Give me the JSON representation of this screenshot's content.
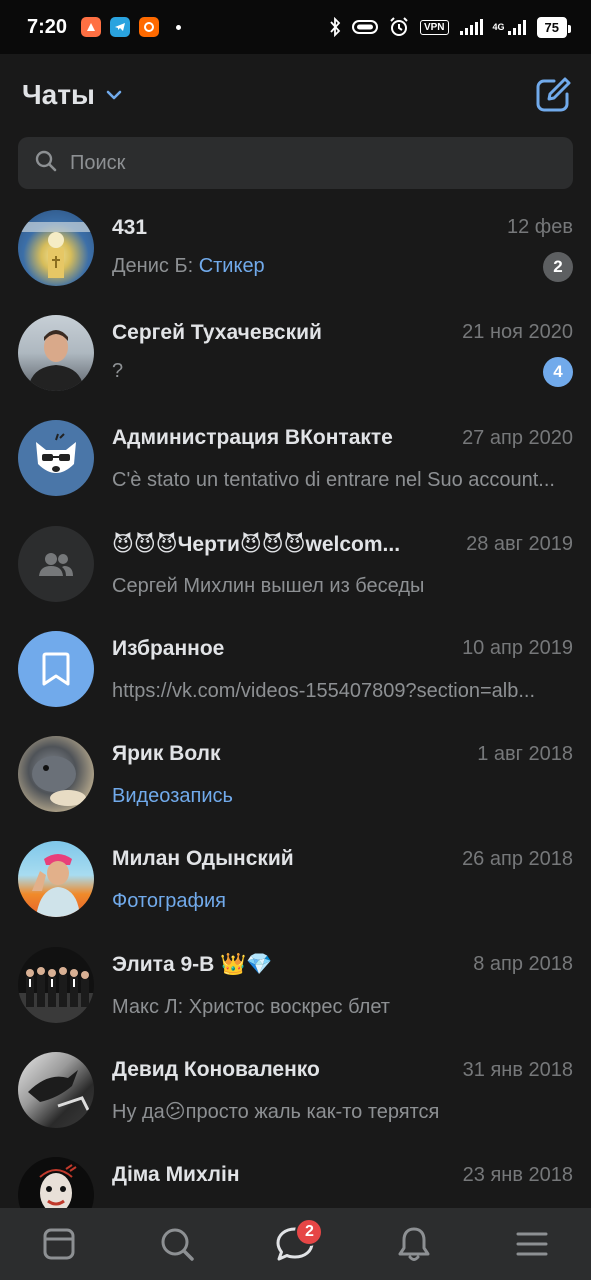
{
  "status_bar": {
    "time": "7:20",
    "battery": "75",
    "vpn": "VPN",
    "network": "4G"
  },
  "header": {
    "title": "Чаты"
  },
  "search": {
    "placeholder": "Поиск"
  },
  "chats": [
    {
      "name": "431",
      "date": "12 фев",
      "sender": "Денис Б: ",
      "message": "Стикер",
      "message_is_link": true,
      "badge": "2",
      "badge_style": "gray"
    },
    {
      "name": "Сергей Тухачевский",
      "date": "21 ноя 2020",
      "message": "?",
      "badge": "4",
      "badge_style": "blue"
    },
    {
      "name": "Администрация ВКонтакте",
      "date": "27 апр 2020",
      "message": "C'è stato un tentativo di entrare nel Suo account..."
    },
    {
      "name": "😈😈😈Черти😈😈😈welcom...",
      "date": "28 авг 2019",
      "message": "Сергей Михлин вышел из беседы"
    },
    {
      "name": "Избранное",
      "date": "10 апр 2019",
      "message": "https://vk.com/videos-155407809?section=alb..."
    },
    {
      "name": "Ярик Волк",
      "date": "1 авг 2018",
      "message": "Видеозапись",
      "message_is_link": true
    },
    {
      "name": "Милан Одынский",
      "date": "26 апр 2018",
      "message": "Фотография",
      "message_is_link": true
    },
    {
      "name": "Элита 9-В 👑💎",
      "date": "8 апр 2018",
      "message": "Макс Л: Христос воскрес блет"
    },
    {
      "name": "Девид Коноваленко",
      "date": "31 янв 2018",
      "message": "Ну да😕просто жаль как-то терятся"
    },
    {
      "name": "Діма Михлін",
      "date": "23 янв 2018",
      "message": ""
    }
  ],
  "tabbar": {
    "messages_badge": "2"
  },
  "colors": {
    "background": "#191919",
    "accent": "#71aaeb",
    "badge_red": "#e64646"
  }
}
